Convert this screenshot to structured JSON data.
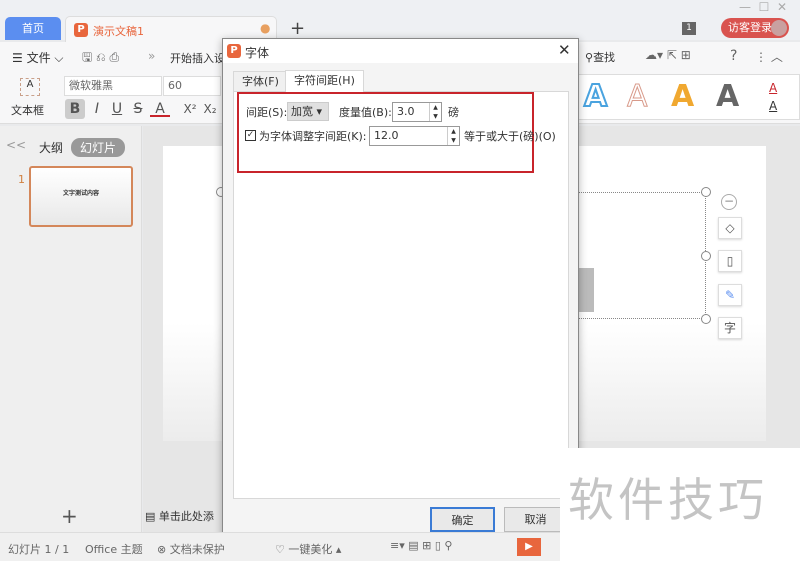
{
  "tabs": {
    "home": "首页",
    "doc": "演示文稿1",
    "new": "+"
  },
  "window": {
    "badge": "1",
    "login": "访客登录"
  },
  "menu": {
    "file": "文件",
    "more": "»",
    "ribbon_tabs": "开始插入设",
    "search": "查找",
    "help": "?"
  },
  "toolbar": {
    "textbox": "文本框",
    "font": "微软雅黑",
    "size": "60",
    "bold": "B",
    "italic": "I",
    "underline": "U",
    "strike": "S",
    "color": "A",
    "sup": "X²",
    "sub": "X₂",
    "styles": [
      "A",
      "A",
      "A",
      "A"
    ]
  },
  "left_panel": {
    "collapse": "<<",
    "outline": "大纲",
    "slides": "幻灯片",
    "slide_number": "1",
    "thumb_text": "文字测试内容",
    "add": "+"
  },
  "notes": "单击此处添",
  "dialog": {
    "title": "字体",
    "tabs": [
      "字体(F)",
      "字符间距(H)"
    ],
    "spacing_label": "间距(S):",
    "spacing_value": "加宽",
    "measure_label": "度量值(B):",
    "measure_value": "3.0",
    "unit": "磅",
    "kerning_checked": true,
    "kerning_label": "为字体调整字间距(K):",
    "kerning_value": "12.0",
    "kerning_suffix": "等于或大于(磅)(O)",
    "ok": "确定",
    "cancel": "取消"
  },
  "status": {
    "slide": "幻灯片 1 / 1",
    "theme": "Office 主题",
    "protect": "文档未保护",
    "beautify": "一键美化"
  },
  "watermark": "软件技巧",
  "colors": {
    "accent": "#5b8ef0",
    "brand": "#e8663d",
    "highlight": "#c8242b",
    "login": "#d9534f"
  }
}
